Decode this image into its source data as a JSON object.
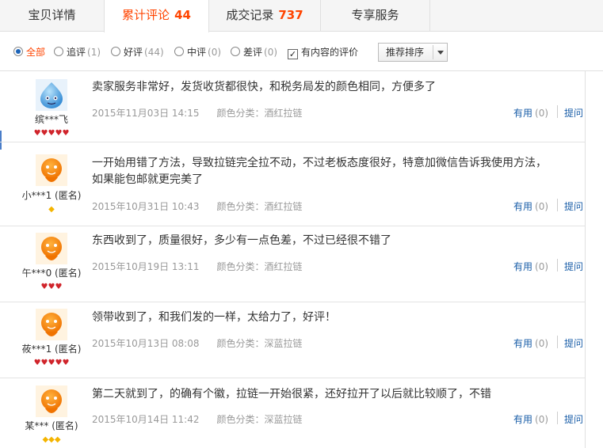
{
  "tabs": [
    {
      "label": "宝贝详情",
      "count": ""
    },
    {
      "label": "累计评论",
      "count": "44"
    },
    {
      "label": "成交记录",
      "count": "737"
    },
    {
      "label": "专享服务",
      "count": ""
    }
  ],
  "filters": {
    "all": {
      "label": "全部"
    },
    "followup": {
      "label": "追评",
      "count": "(1)"
    },
    "good": {
      "label": "好评",
      "count": "(44)"
    },
    "neutral": {
      "label": "中评",
      "count": "(0)"
    },
    "bad": {
      "label": "差评",
      "count": "(0)"
    },
    "with_content": {
      "label": "有内容的评价",
      "checked": true
    },
    "sort_label": "推荐排序"
  },
  "reviews": [
    {
      "nick": "缤***飞",
      "content": "卖家服务非常好，发货收货都很快，和税务局发的颜色相同，方便多了",
      "date": "2015年11月03日 14:15",
      "type": "颜色分类：酒红拉链",
      "rank": "♥♥♥♥♥",
      "avatar": "blue-avatar"
    },
    {
      "nick": "小***1 (匿名)",
      "content": "一开始用错了方法，导致拉链完全拉不动，不过老板态度很好，特意加微信告诉我使用方法，如果能包邮就更完美了",
      "date": "2015年10月31日 10:43",
      "type": "颜色分类：酒红拉链",
      "rank": "◆",
      "avatar": "orange-avatar"
    },
    {
      "nick": "午***0 (匿名)",
      "content": "东西收到了，质量很好，多少有一点色差，不过已经很不错了",
      "date": "2015年10月19日 13:11",
      "type": "颜色分类：酒红拉链",
      "rank": "♥♥♥",
      "avatar": "orange-avatar"
    },
    {
      "nick": "莜***1 (匿名)",
      "content": "领带收到了，和我们发的一样，太给力了，好评！",
      "date": "2015年10月13日 08:08",
      "type": "颜色分类：深蓝拉链",
      "rank": "♥♥♥♥♥",
      "avatar": "orange-avatar"
    },
    {
      "nick": "某*** (匿名)",
      "content": "第二天就到了，的确有个徽，拉链一开始很紧，还好拉开了以后就比较顺了，不错",
      "date": "2015年10月14日 11:42",
      "type": "颜色分类：深蓝拉链",
      "rank": "◆◆◆",
      "avatar": "orange-avatar"
    }
  ],
  "actions": {
    "useful_label": "有用",
    "useful_count": "(0)",
    "ask_label": "提问"
  },
  "colors": {
    "accent": "#ff4400",
    "link": "#1a5ea8",
    "heart": "#d0242b"
  }
}
